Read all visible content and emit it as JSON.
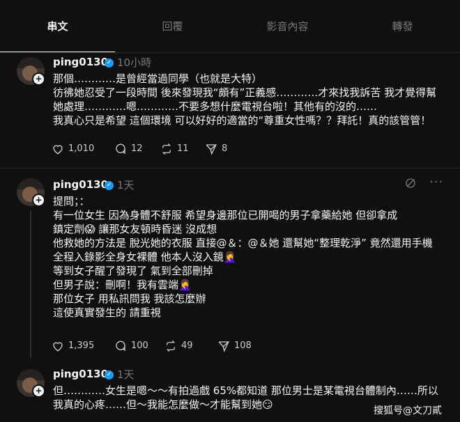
{
  "tabs": [
    "串文",
    "回覆",
    "影音內容",
    "轉發"
  ],
  "posts": [
    {
      "username": "ping0130",
      "time": "10小時",
      "lines": [
        "那個…………是曾經當過同學（也就是大特）",
        "彷彿她忍受了一段時間 後來發現我“頗有”正義感…………才來找我訴苦 我才覺得幫",
        "她處理…………嗯…………不要多想什麼電視台啦！其他有的沒的……",
        "我真心只是希望 這個環境 可以好好的適當的“尊重女性嗎？？拜託！真的該管管！"
      ],
      "likes": "1,010",
      "comments": "12",
      "reposts": "11",
      "shares": "8"
    },
    {
      "username": "ping0130",
      "time": "1天",
      "lines": [
        "提問；：",
        "有一位女生 因為身體不舒服 希望身邊那位已開喝的男子拿藥給她 但卻拿成",
        "鎮定劑😱 讓那女友頓時昏迷 沒成想",
        "他救她的方法是 脫光她的衣服 直接@＆：@＆她 還幫她“整理乾淨” 竟然還用手機",
        "全程入錄影全身女裸體 他本人沒入鏡🤦‍♀️",
        "等到女子醒了發現了 氣到全部刪掉",
        "但男子說：刪啊！我有雲端🤦‍♀️",
        "那位女子 用私訊問我 我該怎麼辦",
        "這使真實發生的 請重視"
      ],
      "likes": "1,395",
      "comments": "100",
      "reposts": "49",
      "shares": "108"
    },
    {
      "username": "ping0130",
      "time": "1天",
      "lines": [
        "但…………女生是嗯～～有拍過戲 65%都知道 那位男士是某電視台體制內……所以",
        "我真的心疼……但～我能怎麼做～才能幫到她😏"
      ]
    }
  ],
  "watermark": "搜狐号@文刀貳",
  "icons": {
    "like": "heart-icon",
    "comment": "comment-icon",
    "repost": "repost-icon",
    "share": "send-icon",
    "more": "more-icon",
    "translate": "translate-icon",
    "verified": "verified-badge-icon",
    "follow": "plus-icon"
  },
  "colors": {
    "background": "#101010",
    "text": "#f3f5f7",
    "muted": "#777777",
    "verified": "#1d9bf0"
  }
}
